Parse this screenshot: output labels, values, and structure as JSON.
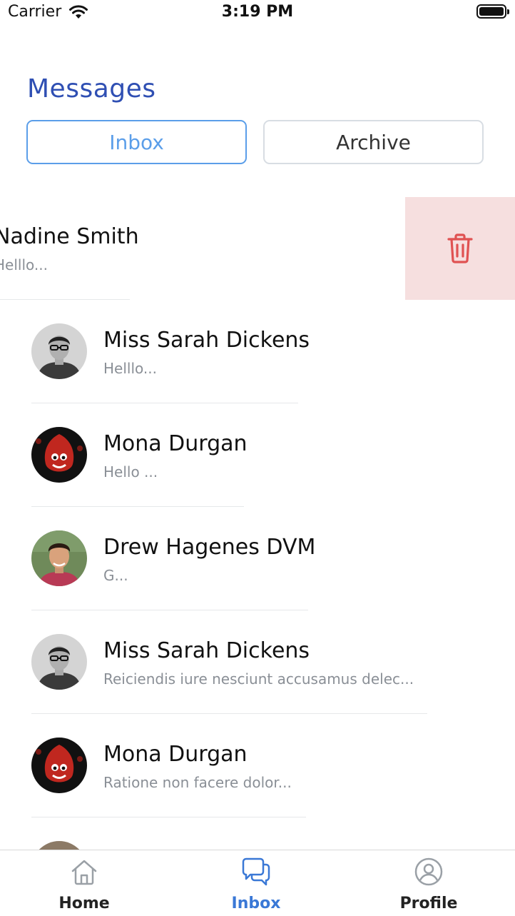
{
  "status_bar": {
    "carrier": "Carrier",
    "time": "3:19 PM"
  },
  "header": {
    "title": "Messages"
  },
  "tabs": {
    "inbox": "Inbox",
    "archive": "Archive"
  },
  "conversations": [
    {
      "name": "Nadine Smith",
      "preview": "Helllo...",
      "avatar": "man-glasses",
      "swiped": true
    },
    {
      "name": "Miss Sarah Dickens",
      "preview": "Helllo...",
      "avatar": "man-glasses"
    },
    {
      "name": "Mona Durgan",
      "preview": "Hello ...",
      "avatar": "red-monster"
    },
    {
      "name": "Drew Hagenes DVM",
      "preview": "G...",
      "avatar": "man-smiling"
    },
    {
      "name": "Miss Sarah Dickens",
      "preview": "Reiciendis iure nesciunt accusamus delec...",
      "avatar": "man-glasses"
    },
    {
      "name": "Mona Durgan",
      "preview": "Ratione non facere dolor...",
      "avatar": "red-monster"
    }
  ],
  "swipe_action": {
    "icon": "trash-icon",
    "color": "#e05252",
    "background": "#f6dfdf"
  },
  "tab_bar": {
    "home": "Home",
    "inbox": "Inbox",
    "profile": "Profile",
    "active": "inbox",
    "active_color": "#3a78d6"
  }
}
